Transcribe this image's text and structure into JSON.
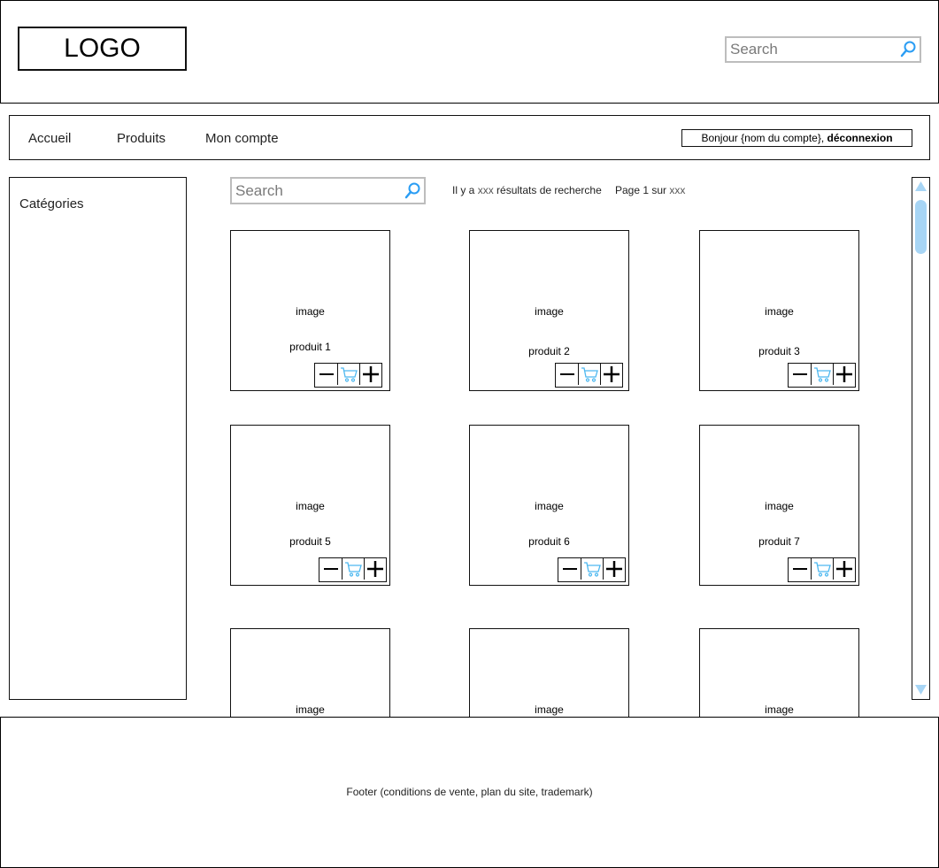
{
  "header": {
    "logo": "LOGO",
    "search_placeholder": "Search"
  },
  "nav": {
    "items": [
      {
        "label": "Accueil"
      },
      {
        "label": "Produits"
      },
      {
        "label": "Mon compte"
      }
    ],
    "account": {
      "greeting": "Bonjour {nom du compte}, ",
      "logout": "déconnexion"
    }
  },
  "sidebar": {
    "title": "Catégories"
  },
  "main": {
    "search_placeholder": "Search",
    "results_prefix": "Il y a ",
    "results_count": "xxx",
    "results_suffix": " résultats de recherche",
    "page_prefix": "Page 1 sur ",
    "page_total": "xxx",
    "image_label": "image",
    "products": [
      {
        "name": "produit 1"
      },
      {
        "name": "produit 2"
      },
      {
        "name": "produit 3"
      },
      {
        "name": "produit 5"
      },
      {
        "name": "produit 6"
      },
      {
        "name": "produit 7"
      },
      {
        "name": ""
      },
      {
        "name": ""
      },
      {
        "name": ""
      }
    ],
    "icons": {
      "minus": "minus-icon",
      "cart": "cart-icon",
      "plus": "plus-icon"
    },
    "accent_color": "#4db8f0"
  },
  "footer": {
    "text": "Footer (conditions de vente, plan du site, trademark)"
  }
}
